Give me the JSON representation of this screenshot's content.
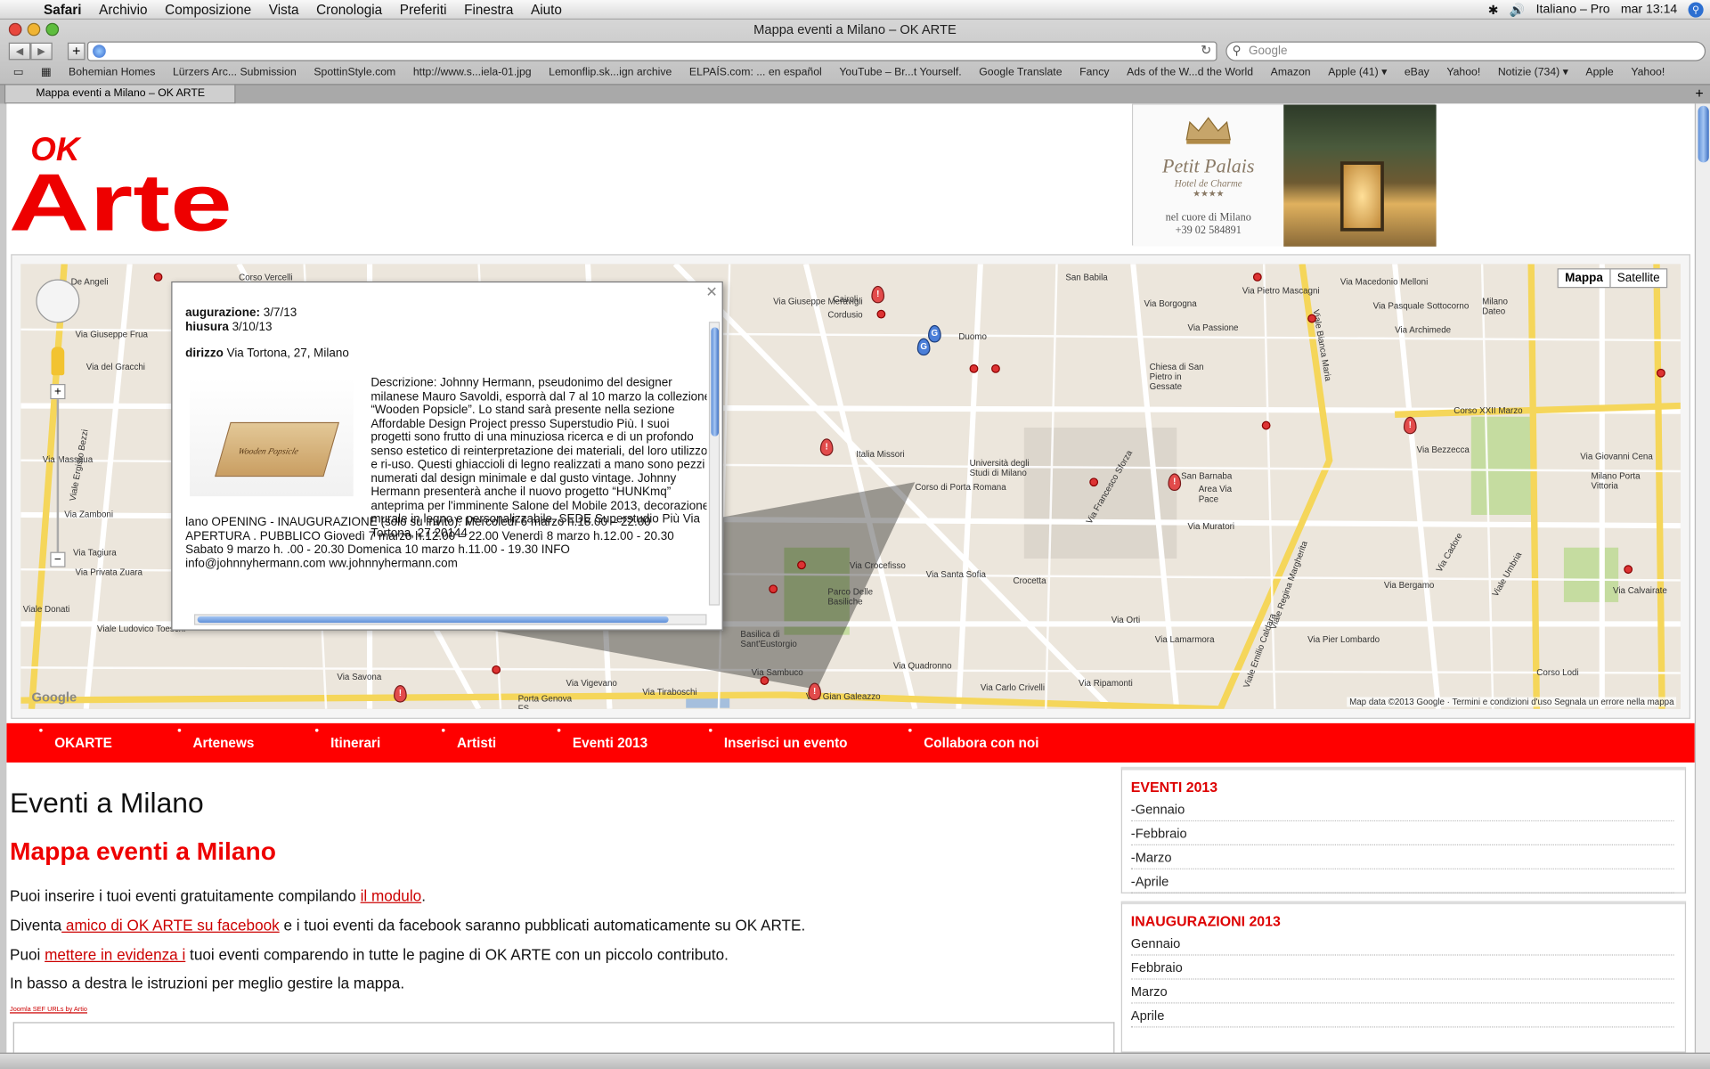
{
  "menubar": {
    "app": "Safari",
    "items": [
      "Archivio",
      "Composizione",
      "Vista",
      "Cronologia",
      "Preferiti",
      "Finestra",
      "Aiuto"
    ],
    "input_source": "Italiano – Pro",
    "clock": "mar 13:14"
  },
  "window": {
    "title": "Mappa eventi a Milano – OK ARTE",
    "search_placeholder": "Google"
  },
  "bookmarks": [
    "Bohemian Homes",
    "Lürzers Arc... Submission",
    "SpottinStyle.com",
    "http://www.s...iela-01.jpg",
    "Lemonflip.sk...ign archive",
    "ELPAÍS.com: ... en español",
    "YouTube – Br...t Yourself.",
    "Google Translate",
    "Fancy",
    "Ads of the W...d the World",
    "Amazon",
    "Apple (41) ▾",
    "eBay",
    "Yahoo!",
    "Notizie (734) ▾",
    "Apple",
    "Yahoo!"
  ],
  "tab": {
    "label": "Mappa eventi a Milano – OK ARTE"
  },
  "logo": {
    "text_ok": "OK",
    "text_arte": "Arte"
  },
  "ad": {
    "brand": "Petit Palais",
    "sub": "Hotel de Charme",
    "stars": "★★★★",
    "line1": "nel cuore di Milano",
    "line2": "+39 02 584891"
  },
  "map": {
    "type_buttons": [
      "Mappa",
      "Satellite"
    ],
    "credit": "Map data ©2013 Google · Termini e condizioni d'uso    Segnala un errore nella mappa",
    "watermark": "Google",
    "labels": [
      "De Angeli",
      "Corso Vercelli",
      "Via Giuseppe Frua",
      "Via del Gracchi",
      "Viale Ergisto Bezzi",
      "Via Massaua",
      "Via Zamboni",
      "Via Tagiura",
      "Via Privata Zuara",
      "Viale Ludovico Toeschi",
      "Viale Donati",
      "Cairoli",
      "Cordusio",
      "Duomo",
      "Italia Missori",
      "Università degli Studi di Milano",
      "Crocetta",
      "Parco Delle Basiliche",
      "Basilica di Sant'Eustorgio",
      "Via Crocefisso",
      "Via Santa Sofia",
      "Via Giuseppe Meravigli",
      "Corso di Porta Romana",
      "Via Francesco Sforza",
      "Chiesa di San Pietro in Gessate",
      "San Babila",
      "Via Borgogna",
      "Via Passione",
      "Via Pietro Mascagni",
      "Via Macedonio Melloni",
      "Via Pasquale Sottocorno",
      "Via Archimede",
      "Milano Dateo",
      "San Barnaba",
      "Area Via Pace",
      "Via Bezzecca",
      "Corso XXII Marzo",
      "Via Giovanni Cena",
      "Milano Porta Vittoria",
      "Viale Umbria",
      "Via Calvairate",
      "Via Vigevano",
      "Porta Genova FS",
      "Via Savona",
      "Vial Gian Galeazzo",
      "Via Ripamonti",
      "Viale Regina Margherita",
      "Viale Bianca Maria",
      "Via Sambuco",
      "Via Carlo Crivelli",
      "Via Quadronno",
      "Via Tiraboschi",
      "Via Orti",
      "Via Lamarmora",
      "Viale Emilio Caldara",
      "Via Muratori",
      "Via Pier Lombardo",
      "Via Bergamo",
      "Via Cadore",
      "Corso Lodi"
    ]
  },
  "infowin": {
    "inaug_label": "augurazione:",
    "inaug_value": "3/7/13",
    "chiusura_label": "hiusura",
    "chiusura_value": "3/10/13",
    "address_label": "dirizzo",
    "address_value": "Via Tortona, 27, Milano",
    "image_caption": "Wooden Popsicle",
    "description": "Descrizione: Johnny Hermann, pseudonimo del designer milanese Mauro Savoldi, esporrà dal 7 al 10 marzo la collezione “Wooden Popsicle”. Lo stand sarà presente nella sezione Affordable Design Project presso Superstudio Più. I suoi progetti sono frutto di una minuziosa ricerca e di un profondo senso estetico di reinterpretazione dei materiali, del loro utilizzo e ri-uso. Questi ghiaccioli di legno realizzati a mano sono pezzi numerati dal design minimale e dal gusto vintage. Johnny Hermann presenterà anche il nuovo progetto “HUNKmq” anteprima per l'imminente Salone del Mobile 2013, decorazione murale in legno e personalizzabile. SEDE Superstudio Più Via Tortona, 27 20144",
    "description2": "lano OPENING - INAUGURAZIONE (solo su invito): Mercoledì 6 marzo h.18.00 – 22.00 APERTURA . PUBBLICO Giovedì 7 marzo h.12.00 – 22.00 Venerdì 8 marzo h.12.00 - 20.30 Sabato 9 marzo h. .00 - 20.30 Domenica 10 marzo h.11.00 - 19.30 INFO info@johnnyhermann.com ww.johnnyhermann.com"
  },
  "nav": [
    "OKARTE",
    "Artenews",
    "Itinerari",
    "Artisti",
    "Eventi 2013",
    "Inserisci un evento",
    "Collabora con noi"
  ],
  "content": {
    "h1": "Eventi a Milano",
    "h2": "Mappa eventi a Milano",
    "p1_pre": "Puoi inserire i tuoi eventi gratuitamente compilando ",
    "p1_link": "il modulo",
    "p1_post": ".",
    "p2_pre": "Diventa",
    "p2_link": " amico di OK ARTE su facebook",
    "p2_post": " e i tuoi eventi da facebook saranno pubblicati automaticamente su OK ARTE.",
    "p3_pre": "Puoi ",
    "p3_link": "mettere in evidenza i",
    "p3_post": " tuoi eventi comparendo in tutte le pagine di OK ARTE con un piccolo contributo.",
    "p4": "In basso a destra le istruzioni per meglio gestire la mappa.",
    "tiny": "Joomla SEF URLs by Artio"
  },
  "sidebar": {
    "eventi_title": "EVENTI 2013",
    "eventi": [
      "-Gennaio",
      "-Febbraio",
      "-Marzo",
      "-Aprile"
    ],
    "inaug_title": "INAUGURAZIONI 2013",
    "inaug": [
      "Gennaio",
      "Febbraio",
      "Marzo",
      "Aprile"
    ]
  },
  "colors": {
    "brand_red": "#ff0000",
    "link_red": "#cc0000"
  }
}
